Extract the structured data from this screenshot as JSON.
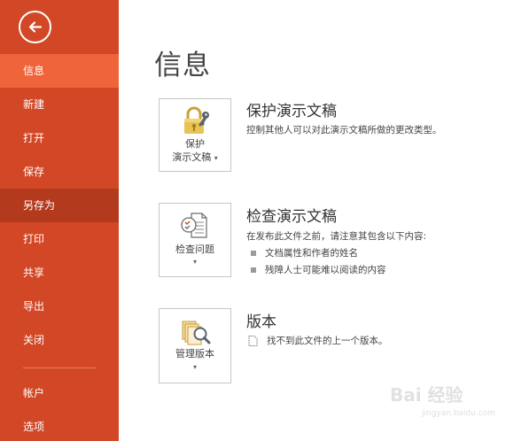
{
  "sidebar": {
    "back_icon": "back-arrow-icon",
    "items": [
      {
        "label": "信息"
      },
      {
        "label": "新建"
      },
      {
        "label": "打开"
      },
      {
        "label": "保存"
      },
      {
        "label": "另存为"
      },
      {
        "label": "打印"
      },
      {
        "label": "共享"
      },
      {
        "label": "导出"
      },
      {
        "label": "关闭"
      }
    ],
    "bottom_items": [
      {
        "label": "帐户"
      },
      {
        "label": "选项"
      }
    ],
    "colors": {
      "background": "#d24726",
      "active": "#f0643c",
      "hover": "#b33a1d"
    }
  },
  "main": {
    "title": "信息",
    "sections": [
      {
        "button_line1": "保护",
        "button_line2": "演示文稿",
        "icon": "lock-key-icon",
        "title": "保护演示文稿",
        "description": "控制其他人可以对此演示文稿所做的更改类型。"
      },
      {
        "button_line1": "检查问题",
        "icon": "inspect-document-icon",
        "title": "检查演示文稿",
        "description": "在发布此文件之前，请注意其包含以下内容:",
        "bullets": [
          "文档属性和作者的姓名",
          "残障人士可能难以阅读的内容"
        ]
      },
      {
        "button_line1": "管理版本",
        "icon": "manage-versions-icon",
        "title": "版本",
        "description": "找不到此文件的上一个版本。"
      }
    ]
  },
  "watermark": {
    "text": "Bai 经验",
    "sub": "jingyan.baidu.com"
  }
}
